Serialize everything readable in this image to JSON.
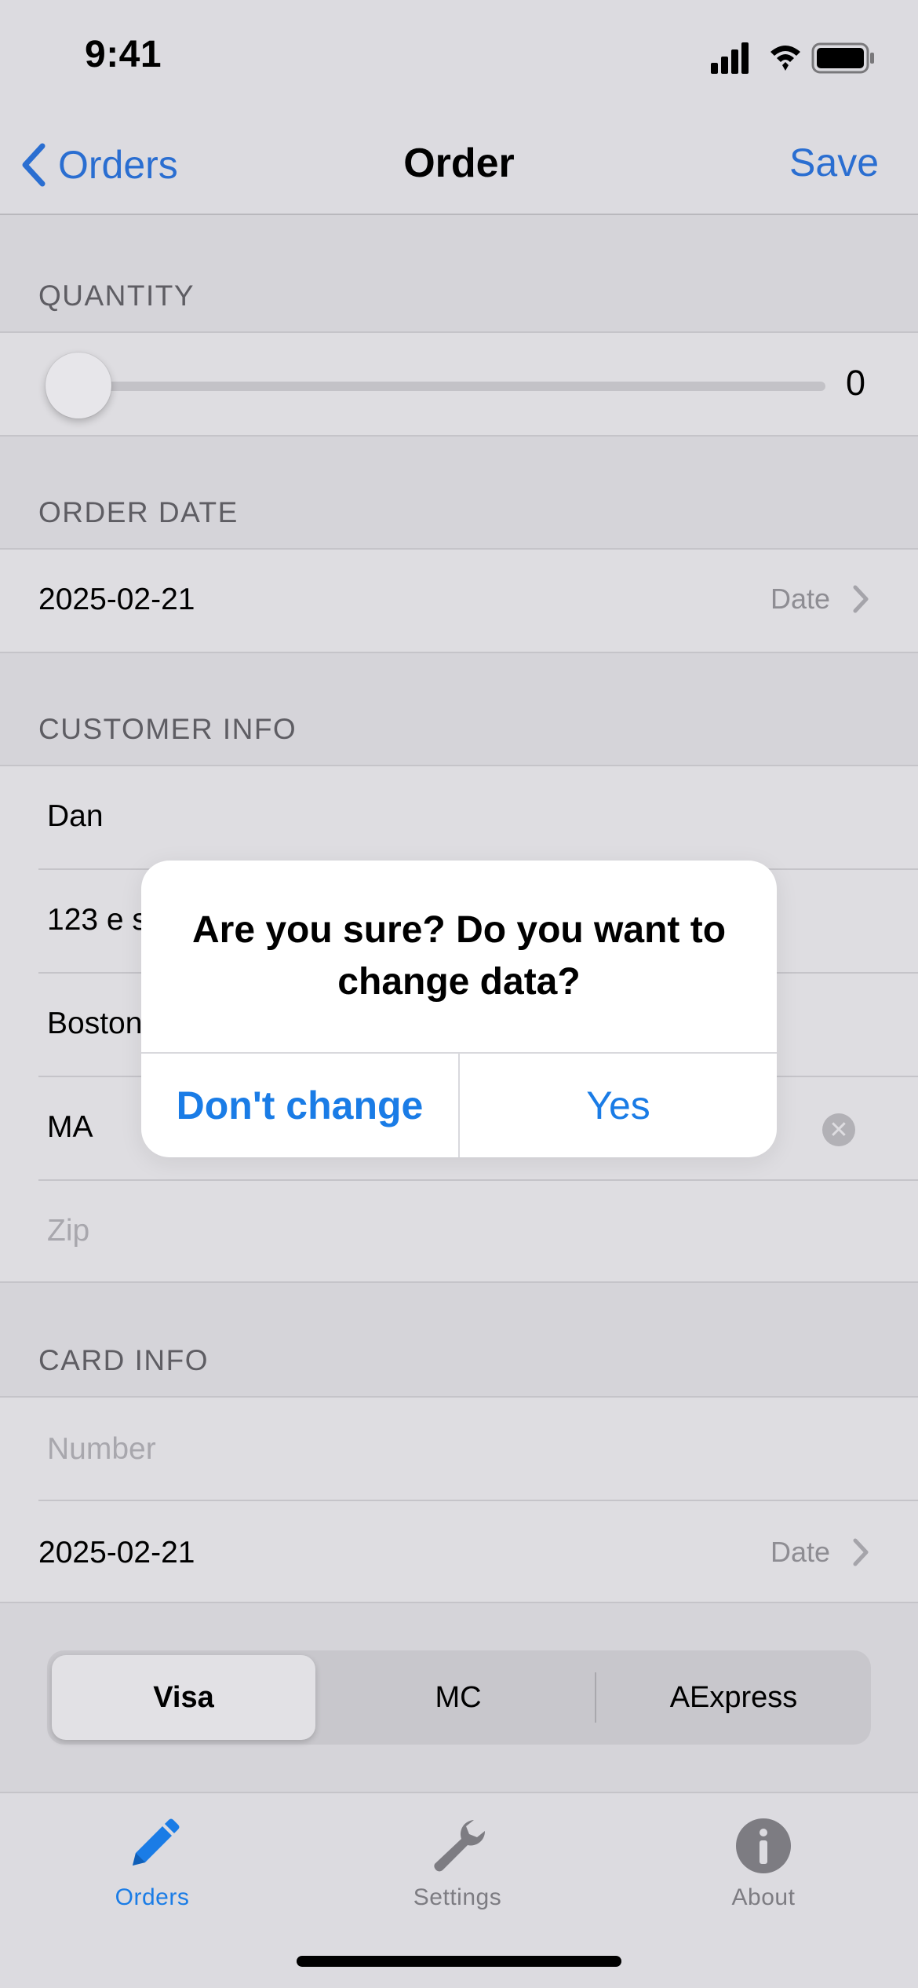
{
  "status_bar": {
    "time": "9:41"
  },
  "nav": {
    "back_label": "Orders",
    "title": "Order",
    "save_label": "Save"
  },
  "quantity": {
    "header": "QUANTITY",
    "value": "0",
    "level": 0
  },
  "order_date": {
    "header": "ORDER DATE",
    "value": "2025-02-21",
    "detail_label": "Date"
  },
  "customer": {
    "header": "CUSTOMER INFO",
    "name": "Dan",
    "street": "123 e s",
    "city": "Boston",
    "state": "MA",
    "zip_placeholder": "Zip"
  },
  "card": {
    "header": "CARD INFO",
    "number_placeholder": "Number",
    "expiry_value": "2025-02-21",
    "expiry_detail_label": "Date"
  },
  "card_type": {
    "options": [
      "Visa",
      "MC",
      "AExpress"
    ],
    "selected": "Visa"
  },
  "alert": {
    "title": "Are you sure? Do you want to change data?",
    "cancel_label": "Don't change",
    "confirm_label": "Yes"
  },
  "tab_bar": {
    "items": [
      {
        "label": "Orders",
        "icon": "pencil-icon",
        "active": true
      },
      {
        "label": "Settings",
        "icon": "wrench-icon",
        "active": false
      },
      {
        "label": "About",
        "icon": "info-icon",
        "active": false
      }
    ]
  },
  "colors": {
    "accent": "#1a7ce6",
    "nav_accent": "#2a6ed1",
    "inactive": "#7d7c82"
  }
}
